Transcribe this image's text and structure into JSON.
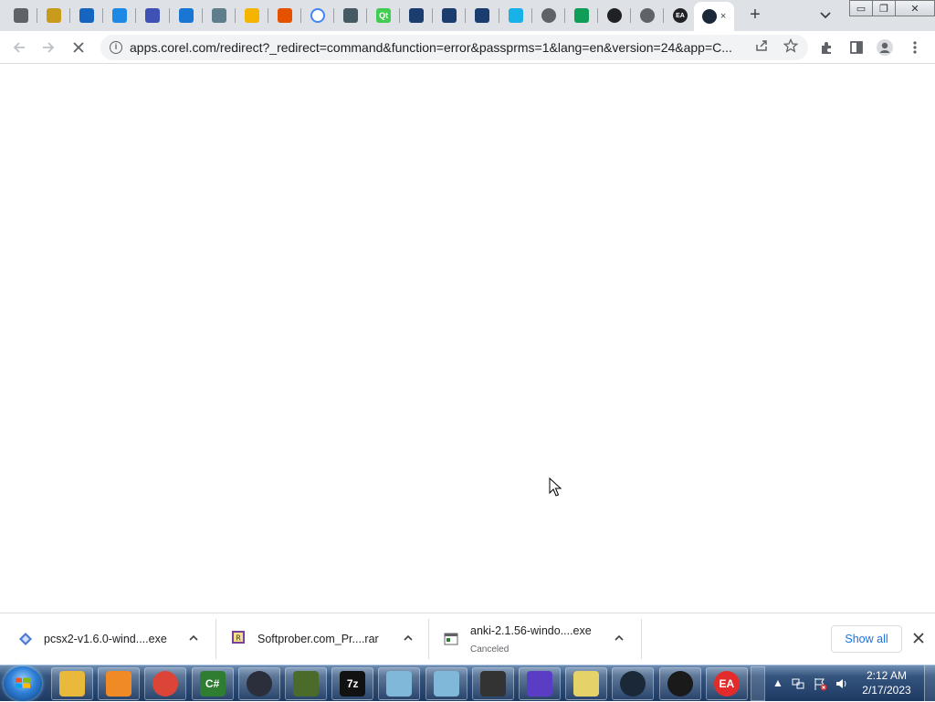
{
  "browser": {
    "tabs": [
      {
        "icon": "gem-icon",
        "color": "#5f6368"
      },
      {
        "icon": "hand-icon",
        "color": "#c89b1c"
      },
      {
        "icon": "m-logo-icon",
        "color": "#1565c0"
      },
      {
        "icon": "pin-icon",
        "color": "#1e88e5"
      },
      {
        "icon": "diamond-icon",
        "color": "#3f51b5"
      },
      {
        "icon": "cloud-icon",
        "color": "#1976d2"
      },
      {
        "icon": "leaf-icon",
        "color": "#607d8b"
      },
      {
        "icon": "hand-yellow-icon",
        "color": "#f4b400"
      },
      {
        "icon": "headphones-icon",
        "color": "#e65100"
      },
      {
        "icon": "google-icon",
        "color": "#4285f4"
      },
      {
        "icon": "tools-icon",
        "color": "#455a64"
      },
      {
        "icon": "qt-icon",
        "color": "#41cd52"
      },
      {
        "icon": "book-icon",
        "color": "#1a3c6e"
      },
      {
        "icon": "book-icon",
        "color": "#1a3c6e"
      },
      {
        "icon": "book-icon",
        "color": "#1a3c6e"
      },
      {
        "icon": "kodi-icon",
        "color": "#17b2e7"
      },
      {
        "icon": "globe-icon",
        "color": "#5f6368"
      },
      {
        "icon": "drive-icon",
        "color": "#0f9d58"
      },
      {
        "icon": "obs-icon",
        "color": "#202124"
      },
      {
        "icon": "globe-icon",
        "color": "#5f6368"
      },
      {
        "icon": "ea-icon",
        "color": "#202124"
      },
      {
        "icon": "steam-icon",
        "color": "#1b2838",
        "active": true
      }
    ],
    "qt_label": "Qt",
    "ea_label": "EA",
    "window_controls": {
      "minimize": "▭",
      "maximize": "❐",
      "close": "✕"
    }
  },
  "toolbar": {
    "url": "apps.corel.com/redirect?_redirect=command&function=error&passprms=1&lang=en&version=24&app=C...",
    "reload_state": "stop"
  },
  "downloads": {
    "items": [
      {
        "name": "pcsx2-v1.6.0-wind....exe",
        "status": "",
        "icon": "pcsx2-icon"
      },
      {
        "name": "Softprober.com_Pr....rar",
        "status": "",
        "icon": "winrar-icon"
      },
      {
        "name": "anki-2.1.56-windo....exe",
        "status": "Canceled",
        "icon": "installer-icon"
      }
    ],
    "show_all_label": "Show all"
  },
  "taskbar": {
    "apps": [
      {
        "name": "explorer-icon",
        "label": "",
        "color": "#e8b93a"
      },
      {
        "name": "media-player-icon",
        "label": "",
        "color": "#f08a24"
      },
      {
        "name": "chrome-icon",
        "label": "",
        "color": "#db4437"
      },
      {
        "name": "csharp-icon",
        "label": "C#",
        "color": "#2e7d32"
      },
      {
        "name": "electron-icon",
        "label": "",
        "color": "#2b2e3b"
      },
      {
        "name": "matrix-icon",
        "label": "",
        "color": "#4a6b2a"
      },
      {
        "name": "7zip-icon",
        "label": "7z",
        "color": "#111111"
      },
      {
        "name": "notepad-icon",
        "label": "",
        "color": "#7fb8d8"
      },
      {
        "name": "notepad2-icon",
        "label": "",
        "color": "#7fb8d8"
      },
      {
        "name": "chip-icon",
        "label": "",
        "color": "#333333"
      },
      {
        "name": "arch-icon",
        "label": "",
        "color": "#5b3cc4"
      },
      {
        "name": "folder-icon",
        "label": "",
        "color": "#e5d36a"
      },
      {
        "name": "steam-icon",
        "label": "",
        "color": "#1b2838"
      },
      {
        "name": "ubisoft-icon",
        "label": "",
        "color": "#1a1a1a"
      },
      {
        "name": "ea-icon",
        "label": "EA",
        "color": "#e32b2b"
      }
    ],
    "clock": {
      "time": "2:12 AM",
      "date": "2/17/2023"
    }
  }
}
